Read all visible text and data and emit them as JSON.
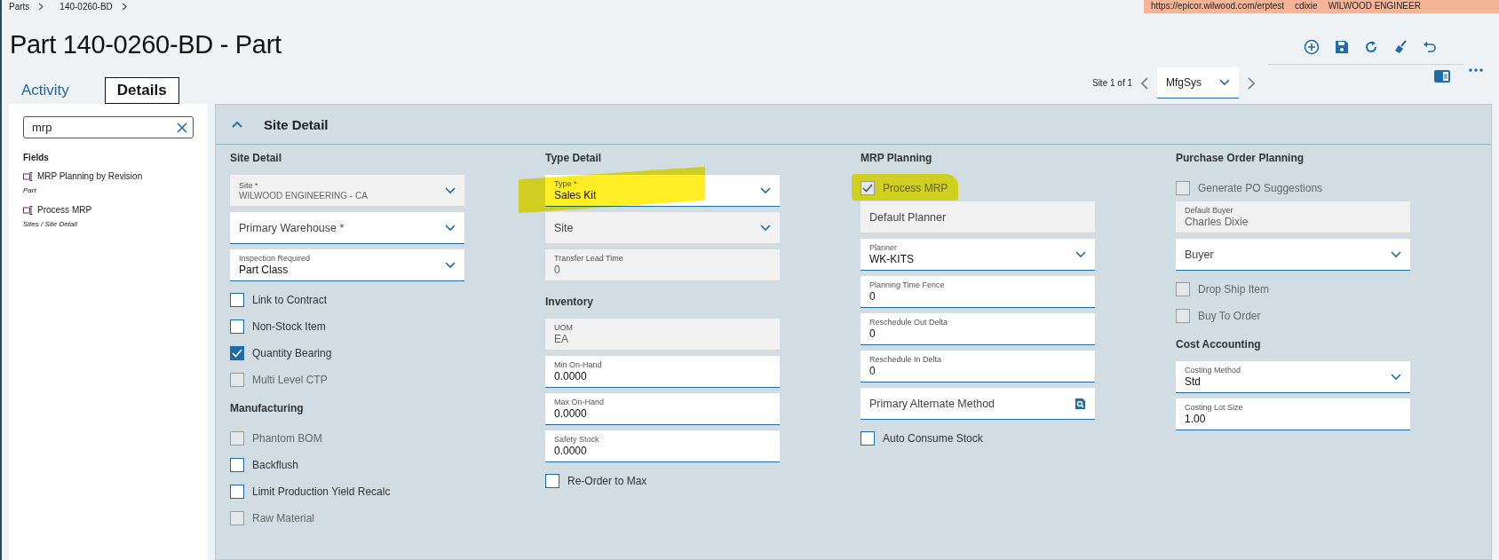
{
  "breadcrumb": [
    {
      "label": "Parts"
    },
    {
      "label": "140-0260-BD"
    }
  ],
  "environment_bar": {
    "url": "https://epicor.wilwood.com/erptest",
    "user": "cdixie",
    "company": "WILWOOD ENGINEER"
  },
  "title": "Part 140-0260-BD - Part",
  "tabs": [
    {
      "label": "Activity",
      "selected": false
    },
    {
      "label": "Details",
      "selected": true
    }
  ],
  "site_nav": {
    "label": "Site 1 of 1",
    "value": "MfgSys"
  },
  "search": {
    "value": "mrp"
  },
  "results": {
    "heading": "Fields",
    "items": [
      {
        "label": "MRP Planning by Revision",
        "path": "Part"
      },
      {
        "label": "Process MRP",
        "path": "Sites / Site Detail"
      }
    ]
  },
  "panel": {
    "title": "Site Detail",
    "expanded": true,
    "columns": [
      [
        {
          "kind": "heading",
          "label": "Site Detail"
        },
        {
          "kind": "dropdown",
          "label": "Site *",
          "value": "WILWOOD ENGINEERING - CA",
          "disabled": true,
          "highlighted": false
        },
        {
          "kind": "dropdown",
          "label": "Primary Warehouse *",
          "disabled": false,
          "highlighted": false
        },
        {
          "kind": "dropdown",
          "label": "Inspection Required",
          "value": "Part Class",
          "disabled": false,
          "highlighted": false
        },
        {
          "kind": "checkbox",
          "label": "Link to Contract",
          "checked": false,
          "disabled": false,
          "highlighted": false
        },
        {
          "kind": "checkbox",
          "label": "Non-Stock Item",
          "checked": false,
          "disabled": false,
          "highlighted": false
        },
        {
          "kind": "checkbox",
          "label": "Quantity Bearing",
          "checked": true,
          "disabled": false,
          "highlighted": false
        },
        {
          "kind": "checkbox",
          "label": "Multi Level CTP",
          "checked": false,
          "disabled": true,
          "highlighted": false
        },
        {
          "kind": "heading",
          "label": "Manufacturing"
        },
        {
          "kind": "checkbox",
          "label": "Phantom BOM",
          "checked": false,
          "disabled": true,
          "highlighted": false
        },
        {
          "kind": "checkbox",
          "label": "Backflush",
          "checked": false,
          "disabled": false,
          "highlighted": false
        },
        {
          "kind": "checkbox",
          "label": "Limit Production Yield Recalc",
          "checked": false,
          "disabled": false,
          "highlighted": false
        },
        {
          "kind": "checkbox",
          "label": "Raw Material",
          "checked": false,
          "disabled": true,
          "highlighted": false
        }
      ],
      [
        {
          "kind": "heading",
          "label": "Type Detail"
        },
        {
          "kind": "dropdown",
          "label": "Type *",
          "value": "Sales Kit",
          "disabled": false,
          "highlighted": true
        },
        {
          "kind": "dropdown",
          "label": "Site",
          "disabled": true,
          "highlighted": false
        },
        {
          "kind": "text",
          "label": "Transfer Lead Time",
          "value": "0",
          "disabled": true,
          "highlighted": false
        },
        {
          "kind": "heading",
          "label": "Inventory"
        },
        {
          "kind": "text",
          "label": "UOM",
          "value": "EA",
          "disabled": true,
          "highlighted": false
        },
        {
          "kind": "text",
          "label": "Min On-Hand",
          "value": "0.0000",
          "disabled": false,
          "highlighted": false
        },
        {
          "kind": "text",
          "label": "Max On-Hand",
          "value": "0.0000",
          "disabled": false,
          "highlighted": false
        },
        {
          "kind": "text",
          "label": "Safety Stock",
          "value": "0.0000",
          "disabled": false,
          "highlighted": false
        },
        {
          "kind": "checkbox",
          "label": "Re-Order to Max",
          "checked": false,
          "disabled": false,
          "highlighted": false
        }
      ],
      [
        {
          "kind": "heading",
          "label": "MRP Planning"
        },
        {
          "kind": "checkbox",
          "label": "Process MRP",
          "checked": true,
          "disabled": true,
          "highlighted": true
        },
        {
          "kind": "text",
          "label": "Default Planner",
          "disabled": true,
          "highlighted": false
        },
        {
          "kind": "dropdown",
          "label": "Planner",
          "value": "WK-KITS",
          "disabled": false,
          "highlighted": false
        },
        {
          "kind": "text",
          "label": "Planning Time Fence",
          "value": "0",
          "disabled": false,
          "highlighted": false
        },
        {
          "kind": "text",
          "label": "Reschedule Out Delta",
          "value": "0",
          "disabled": false,
          "highlighted": false
        },
        {
          "kind": "text",
          "label": "Reschedule In Delta",
          "value": "0",
          "disabled": false,
          "highlighted": false
        },
        {
          "kind": "lookup",
          "label": "Primary Alternate Method",
          "disabled": false,
          "highlighted": false
        },
        {
          "kind": "checkbox",
          "label": "Auto Consume Stock",
          "checked": false,
          "disabled": false,
          "highlighted": false
        }
      ],
      [
        {
          "kind": "heading",
          "label": "Purchase Order Planning"
        },
        {
          "kind": "checkbox",
          "label": "Generate PO Suggestions",
          "checked": false,
          "disabled": true,
          "highlighted": false
        },
        {
          "kind": "text",
          "label": "Default Buyer",
          "value": "Charles Dixie",
          "disabled": true,
          "highlighted": false
        },
        {
          "kind": "dropdown",
          "label": "Buyer",
          "disabled": false,
          "highlighted": false
        },
        {
          "kind": "checkbox",
          "label": "Drop Ship Item",
          "checked": false,
          "disabled": true,
          "highlighted": false
        },
        {
          "kind": "checkbox",
          "label": "Buy To Order",
          "checked": false,
          "disabled": true,
          "highlighted": false
        },
        {
          "kind": "heading",
          "label": "Cost Accounting"
        },
        {
          "kind": "dropdown",
          "label": "Costing Method",
          "value": "Std",
          "disabled": false,
          "highlighted": false
        },
        {
          "kind": "text",
          "label": "Costing Lot Size",
          "value": "1.00",
          "disabled": false,
          "highlighted": false
        }
      ]
    ]
  }
}
